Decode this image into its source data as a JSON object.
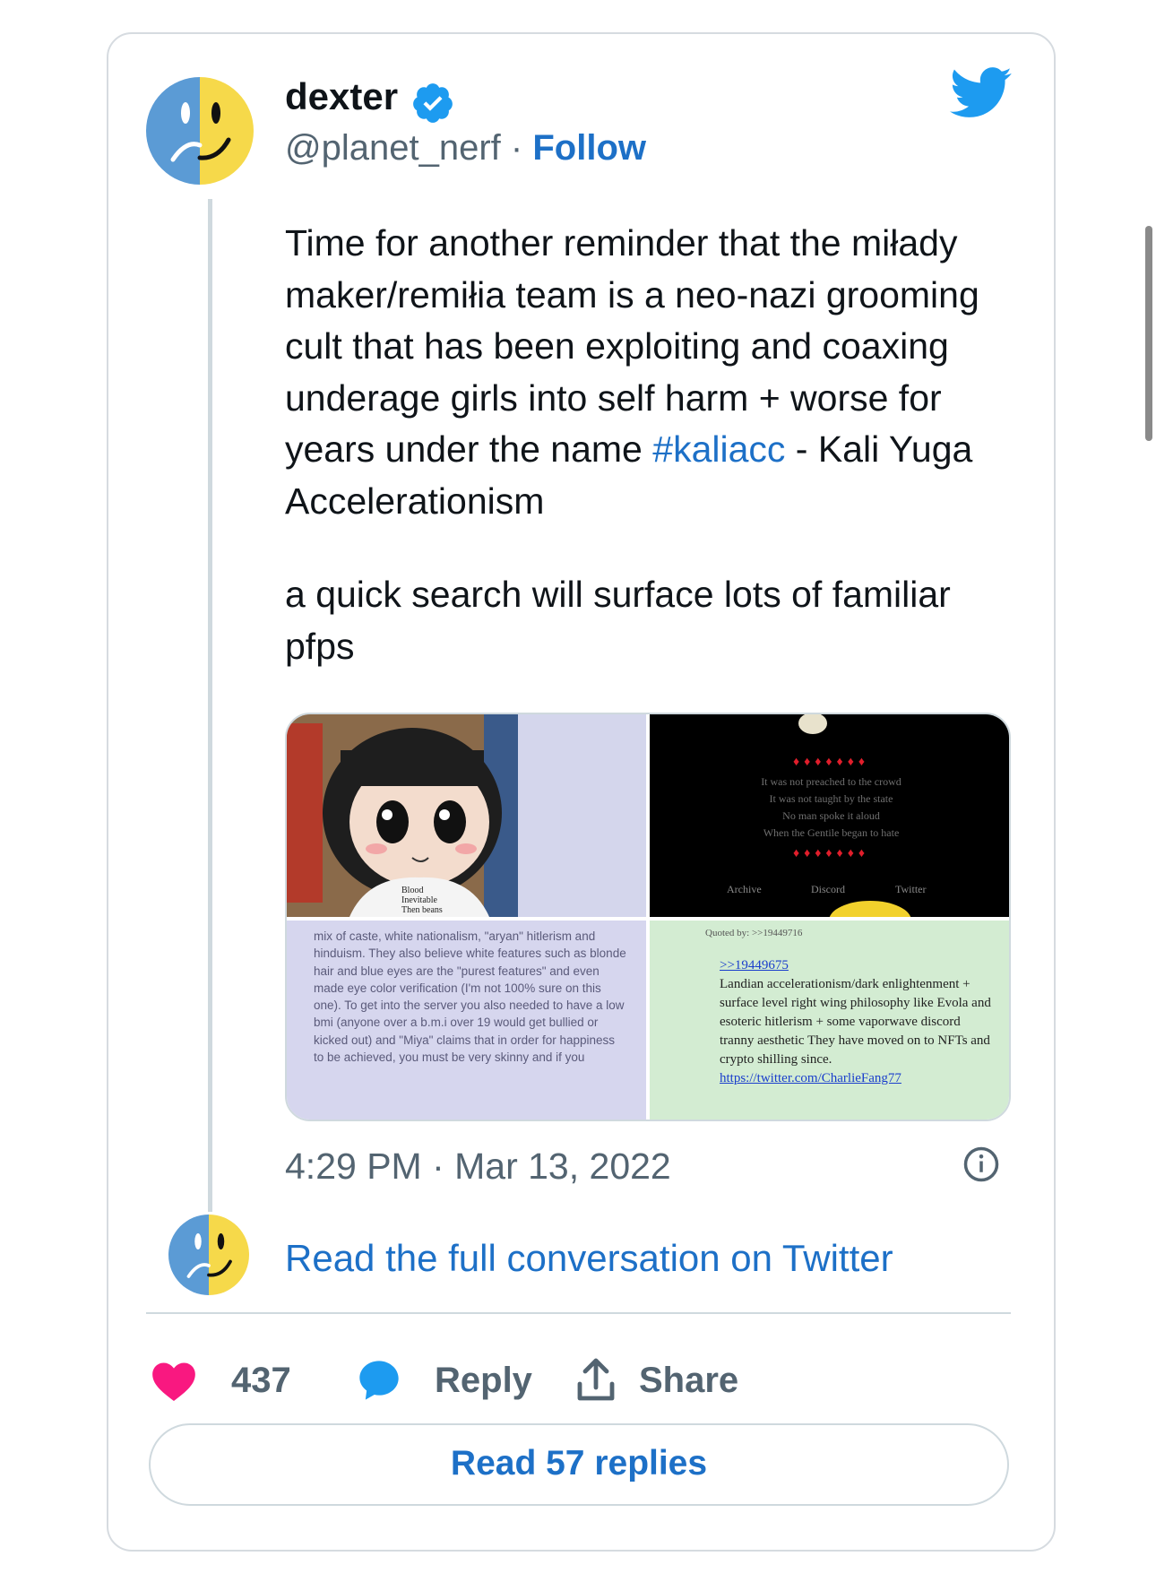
{
  "author": {
    "name": "dexter",
    "handle": "@planet_nerf",
    "separator": "·",
    "follow_label": "Follow"
  },
  "tweet": {
    "lines_para1_plain": "Time for another reminder that the miłady maker/remiłia team is a neo-nazi grooming cult that has been exploiting and coaxing underage girls into self harm + worse for years under the name",
    "hashtag": "#kaliacc",
    "after_hashtag": " - Kali Yuga Accelerationism",
    "para2": "a quick search will surface lots of familiar pfps",
    "timestamp": "4:29 PM · Mar 13, 2022"
  },
  "media": {
    "q1": {
      "shirt_lines": [
        "Blood",
        "Inevitable",
        "Then beans"
      ]
    },
    "q2": {
      "drops": "♦♦♦♦♦♦♦",
      "poem": [
        "It was not preached to the crowd",
        "It was not taught by the state",
        "No man spoke it aloud",
        "When the Gentile began to hate"
      ],
      "nav": [
        "Archive",
        "Discord",
        "Twitter"
      ]
    },
    "q3": {
      "text": "mix of caste, white nationalism, \"aryan\" hitlerism and hinduism. They also believe white features such as blonde hair and blue eyes are the \"purest features\" and even made eye color verification (I'm not 100% sure on this one). To get into the server you also needed to have a low bmi (anyone over a b.m.i over 19 would get bullied or kicked out) and \"Miya\" claims that in order for happiness to be achieved, you must be very skinny and if you"
    },
    "q4": {
      "quoted_by": "Quoted by: >>19449716",
      "ref": ">>19449675",
      "text": "Landian accelerationism/dark enlightenment + surface level right wing philosophy like Evola and esoteric hitlerism + some vaporwave discord tranny aesthetic They have moved on to NFTs and crypto shilling since.",
      "link": "https://twitter.com/CharlieFang77"
    }
  },
  "conversation_link": "Read the full conversation on Twitter",
  "actions": {
    "likes": "437",
    "reply_label": "Reply",
    "share_label": "Share"
  },
  "read_replies_label": "Read 57 replies",
  "colors": {
    "accent": "#1d70c7",
    "heart": "#f91880",
    "text": "#0f1419",
    "muted": "#536471",
    "border": "#cfd9de"
  },
  "icons": [
    "twitter-bird-icon",
    "verified-badge-icon",
    "info-icon",
    "heart-icon",
    "reply-bubble-icon",
    "share-icon"
  ]
}
